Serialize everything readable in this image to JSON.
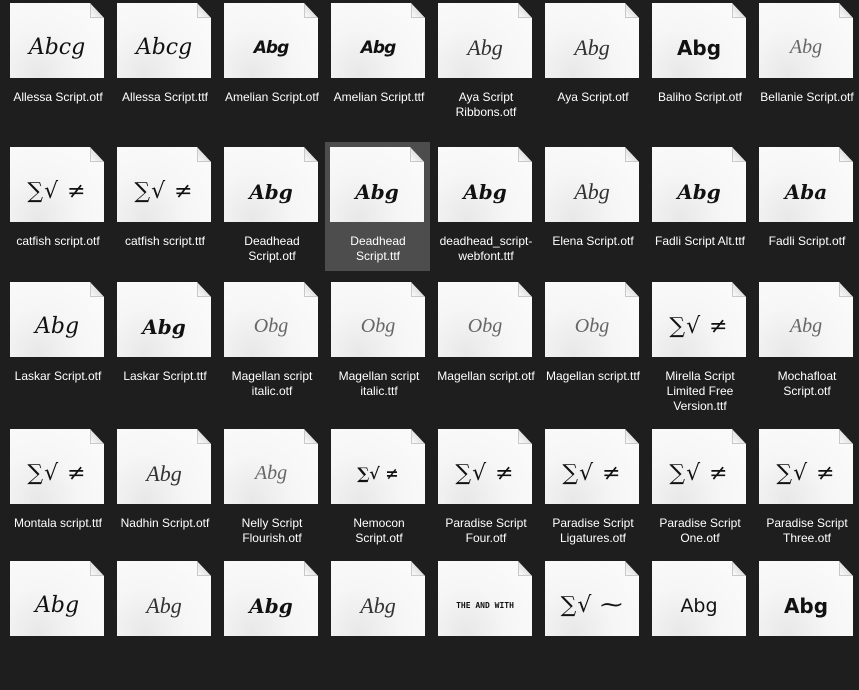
{
  "view": "file-explorer-large-icons",
  "selected_index": 11,
  "colors": {
    "background": "#1e1e1e",
    "selection": "#4d4d4d",
    "label_text": "#ffffff",
    "thumbnail": "#f8f8f8"
  },
  "files": [
    {
      "name": "Allessa Script.otf",
      "preview": "Abcg",
      "style": "s-script"
    },
    {
      "name": "Allessa Script.ttf",
      "preview": "Abcg",
      "style": "s-script"
    },
    {
      "name": "Amelian Script.otf",
      "preview": "Abg",
      "style": "s-rough"
    },
    {
      "name": "Amelian Script.ttf",
      "preview": "Abg",
      "style": "s-rough"
    },
    {
      "name": "Aya Script Ribbons.otf",
      "preview": "Abg",
      "style": "s-script-thin"
    },
    {
      "name": "Aya Script.otf",
      "preview": "Abg",
      "style": "s-script-thin"
    },
    {
      "name": "Baliho Script.otf",
      "preview": "Abg",
      "style": "s-bold"
    },
    {
      "name": "Bellanie Script.otf",
      "preview": "Abg",
      "style": "s-script-light"
    },
    {
      "name": "catfish script.otf",
      "preview": "∑√ ≠",
      "style": "s-math"
    },
    {
      "name": "catfish script.ttf",
      "preview": "∑√ ≠",
      "style": "s-math"
    },
    {
      "name": "Deadhead Script.otf",
      "preview": "Abg",
      "style": "s-bold-italic"
    },
    {
      "name": "Deadhead Script.ttf",
      "preview": "Abg",
      "style": "s-bold-italic"
    },
    {
      "name": "deadhead_script-webfont.ttf",
      "preview": "Abg",
      "style": "s-bold-italic"
    },
    {
      "name": "Elena Script.otf",
      "preview": "Abg",
      "style": "s-script-thin"
    },
    {
      "name": "Fadli Script Alt.ttf",
      "preview": "Abg",
      "style": "s-bold-italic"
    },
    {
      "name": "Fadli Script.otf",
      "preview": "Aba",
      "style": "s-bold-italic"
    },
    {
      "name": "Laskar Script.otf",
      "preview": "Abg",
      "style": "s-script"
    },
    {
      "name": "Laskar Script.ttf",
      "preview": "Abg",
      "style": "s-bold-italic"
    },
    {
      "name": "Magellan script italic.otf",
      "preview": "Obg",
      "style": "s-script-light"
    },
    {
      "name": "Magellan script italic.ttf",
      "preview": "Obg",
      "style": "s-script-light"
    },
    {
      "name": "Magellan script.otf",
      "preview": "Obg",
      "style": "s-script-light"
    },
    {
      "name": "Magellan script.ttf",
      "preview": "Obg",
      "style": "s-script-light"
    },
    {
      "name": "Mirella Script Limited Free Version.ttf",
      "preview": "∑√ ≠",
      "style": "s-math"
    },
    {
      "name": "Mochafloat Script.otf",
      "preview": "Abg",
      "style": "s-script-light"
    },
    {
      "name": "Montala script.ttf",
      "preview": "∑√ ≠",
      "style": "s-math"
    },
    {
      "name": "Nadhin Script.otf",
      "preview": "Abg",
      "style": "s-script-thin"
    },
    {
      "name": "Nelly Script Flourish.otf",
      "preview": "Abg",
      "style": "s-script-light"
    },
    {
      "name": "Nemocon Script.otf",
      "preview": "∑√ ≠",
      "style": "s-math-small"
    },
    {
      "name": "Paradise Script Four.otf",
      "preview": "∑√ ≠",
      "style": "s-math"
    },
    {
      "name": "Paradise Script Ligatures.otf",
      "preview": "∑√ ≠",
      "style": "s-math"
    },
    {
      "name": "Paradise Script One.otf",
      "preview": "∑√ ≠",
      "style": "s-math"
    },
    {
      "name": "Paradise Script Three.otf",
      "preview": "∑√ ≠",
      "style": "s-math"
    },
    {
      "name": "",
      "preview": "Abg",
      "style": "s-script"
    },
    {
      "name": "",
      "preview": "Abg",
      "style": "s-script-thin"
    },
    {
      "name": "",
      "preview": "Abg",
      "style": "s-bold-italic"
    },
    {
      "name": "",
      "preview": "Abg",
      "style": "s-script-thin"
    },
    {
      "name": "",
      "preview": "THE AND WITH",
      "style": "s-banner"
    },
    {
      "name": "",
      "preview": "∑√ ⁓",
      "style": "s-math"
    },
    {
      "name": "",
      "preview": "Abg",
      "style": "s-handwrite"
    },
    {
      "name": "",
      "preview": "Abg",
      "style": "s-bold"
    }
  ]
}
